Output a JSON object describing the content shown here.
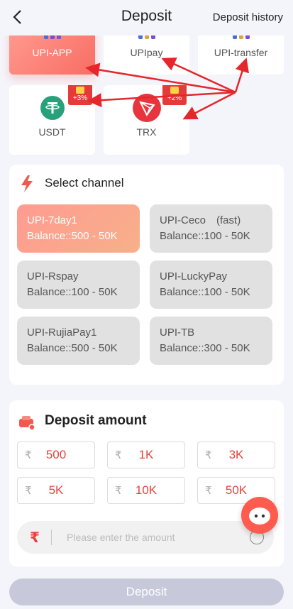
{
  "header": {
    "title": "Deposit",
    "history_link": "Deposit history"
  },
  "payment_methods": [
    {
      "label": "UPI-APP",
      "selected": true
    },
    {
      "label": "UPIpay",
      "selected": false
    },
    {
      "label": "UPI-transfer",
      "selected": false
    },
    {
      "label": "USDT",
      "selected": false,
      "bonus": "+3%"
    },
    {
      "label": "TRX",
      "selected": false,
      "bonus": "+2%"
    }
  ],
  "channel_section": {
    "title": "Select channel",
    "channels": [
      {
        "name": "UPI-7day1",
        "balance": "Balance::500 - 50K",
        "selected": true
      },
      {
        "name": "UPI-Ceco　(fast)",
        "balance": "Balance::100 - 50K",
        "selected": false
      },
      {
        "name": "UPI-Rspay",
        "balance": "Balance::100 - 50K",
        "selected": false
      },
      {
        "name": "UPI-LuckyPay",
        "balance": "Balance::100 - 50K",
        "selected": false
      },
      {
        "name": "UPI-RujiaPay1",
        "balance": "Balance::500 - 50K",
        "selected": false
      },
      {
        "name": "UPI-TB",
        "balance": "Balance::300 - 50K",
        "selected": false
      }
    ]
  },
  "amount_section": {
    "title": "Deposit amount",
    "currency_symbol": "₹",
    "presets": [
      "500",
      "1K",
      "3K",
      "5K",
      "10K",
      "50K"
    ],
    "input_placeholder": "Please enter the amount",
    "input_value": ""
  },
  "deposit_button": "Deposit",
  "colors": {
    "accent": "#f96d63",
    "amount_red": "#e5423d",
    "annotation_arrow": "#e5262a",
    "usdt_green": "#26a17b",
    "trx_red": "#e8343f",
    "disabled_button": "#c7c9da"
  }
}
